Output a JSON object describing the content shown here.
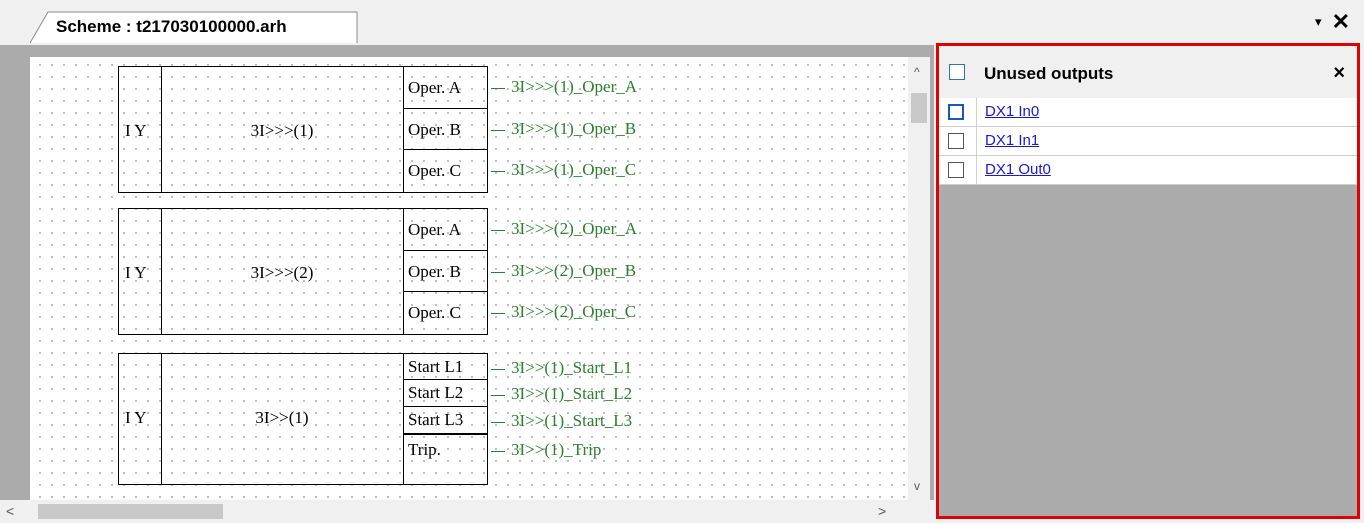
{
  "tab": {
    "title": "Scheme : t217030100000.arh"
  },
  "window_controls": {
    "dropdown_icon": "▾",
    "close_icon": "✕"
  },
  "blocks": [
    {
      "input": "I Y",
      "name": "3I>>>(1)",
      "ports": [
        "Oper. A",
        "Oper. B",
        "Oper. C"
      ],
      "signals": [
        "3I>>>(1)_Oper_A",
        "3I>>>(1)_Oper_B",
        "3I>>>(1)_Oper_C"
      ]
    },
    {
      "input": "I Y",
      "name": "3I>>>(2)",
      "ports": [
        "Oper. A",
        "Oper. B",
        "Oper. C"
      ],
      "signals": [
        "3I>>>(2)_Oper_A",
        "3I>>>(2)_Oper_B",
        "3I>>>(2)_Oper_C"
      ]
    },
    {
      "input": "I Y",
      "name": "3I>>(1)",
      "ports": [
        "Start L1",
        "Start L2",
        "Start L3",
        "Trip."
      ],
      "signals": [
        "3I>>(1)_Start_L1",
        "3I>>(1)_Start_L2",
        "3I>>(1)_Start_L3",
        "3I>>(1)_Trip"
      ]
    }
  ],
  "scrollbars": {
    "up_arrow": "^",
    "down_arrow": "v",
    "left_arrow": "<",
    "right_arrow": ">"
  },
  "unused_outputs": {
    "title": "Unused outputs",
    "close_label": "×",
    "items": [
      {
        "label": "DX1 In0",
        "checked": false,
        "focused": true
      },
      {
        "label": "DX1 In1",
        "checked": false,
        "focused": false
      },
      {
        "label": "DX1 Out0",
        "checked": false,
        "focused": false
      }
    ]
  },
  "colors": {
    "signal": "#2e7d32",
    "highlight_border": "#e00000",
    "link": "#1a1acc"
  }
}
